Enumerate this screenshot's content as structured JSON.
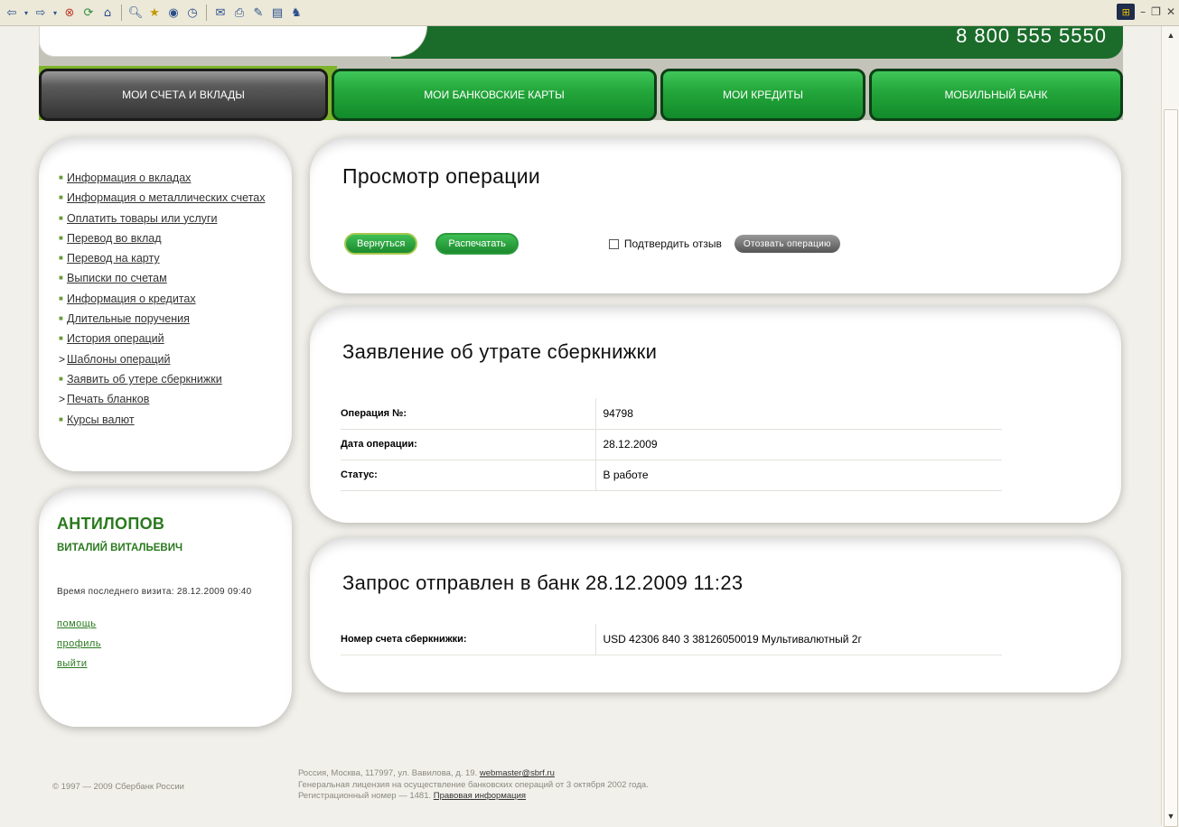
{
  "browser": {
    "toolbar_icons": [
      "back-icon",
      "back-dropdown-icon",
      "forward-icon",
      "forward-dropdown-icon",
      "stop-icon",
      "refresh-icon",
      "home-icon",
      "search-icon",
      "favorites-icon",
      "media-icon",
      "history-icon",
      "mail-icon",
      "print-icon",
      "edit-icon",
      "discuss-icon",
      "messenger-icon"
    ],
    "window_controls": [
      "minimize",
      "restore",
      "close"
    ]
  },
  "header": {
    "phone": "8 800 555 5550"
  },
  "nav": {
    "tabs": [
      {
        "label": "МОИ СЧЕТА И ВКЛАДЫ",
        "active": true
      },
      {
        "label": "МОИ БАНКОВСКИЕ КАРТЫ",
        "active": false
      },
      {
        "label": "МОИ КРЕДИТЫ",
        "active": false
      },
      {
        "label": "МОБИЛЬНЫЙ БАНК",
        "active": false
      }
    ]
  },
  "sidebar": {
    "items": [
      {
        "label": "Информация о вкладах",
        "bullet": "square"
      },
      {
        "label": "Информация о металлических счетах",
        "bullet": "square"
      },
      {
        "label": "Оплатить товары или услуги",
        "bullet": "square"
      },
      {
        "label": "Перевод во вклад",
        "bullet": "square"
      },
      {
        "label": "Перевод на карту",
        "bullet": "square"
      },
      {
        "label": "Выписки по счетам",
        "bullet": "square"
      },
      {
        "label": "Информация о кредитах",
        "bullet": "square"
      },
      {
        "label": "Длительные поручения",
        "bullet": "square"
      },
      {
        "label": "История операций",
        "bullet": "square"
      },
      {
        "label": "Шаблоны операций",
        "bullet": "arrow"
      },
      {
        "label": "Заявить об утере сберкнижки",
        "bullet": "square"
      },
      {
        "label": "Печать бланков",
        "bullet": "arrow"
      },
      {
        "label": "Курсы валют",
        "bullet": "square"
      }
    ]
  },
  "user": {
    "last_name": "АНТИЛОПОВ",
    "first_name": "ВИТАЛИЙ ВИТАЛЬЕВИЧ",
    "last_visit": "Время последнего визита: 28.12.2009 09:40",
    "links": {
      "help": "помощь",
      "profile": "профиль",
      "logout": "выйти"
    }
  },
  "operation": {
    "title": "Просмотр операции",
    "back_label": "Вернуться",
    "print_label": "Распечатать",
    "confirm_label": "Подтвердить отзыв",
    "revoke_label": "Отозвать операцию"
  },
  "claim": {
    "title": "Заявление об утрате сберкнижки",
    "rows": [
      {
        "key": "Операция №:",
        "value": "94798"
      },
      {
        "key": "Дата операции:",
        "value": "28.12.2009"
      },
      {
        "key": "Статус:",
        "value": "В работе"
      }
    ]
  },
  "request": {
    "title": "Запрос отправлен в банк 28.12.2009 11:23",
    "rows": [
      {
        "key": "Номер счета сберкнижки:",
        "value": "USD 42306 840 3 38126050019 Мультивалютный 2г"
      }
    ]
  },
  "footer": {
    "copyright": "© 1997 — 2009 Сбербанк России",
    "address": "Россия, Москва, 117997, ул. Вавилова, д. 19.",
    "email": "webmaster@sbrf.ru",
    "license": "Генеральная лицензия на осуществление банковских операций от 3 октября 2002 года.",
    "reg_number": "Регистрационный номер — 1481.",
    "legal_link": "Правовая информация"
  }
}
